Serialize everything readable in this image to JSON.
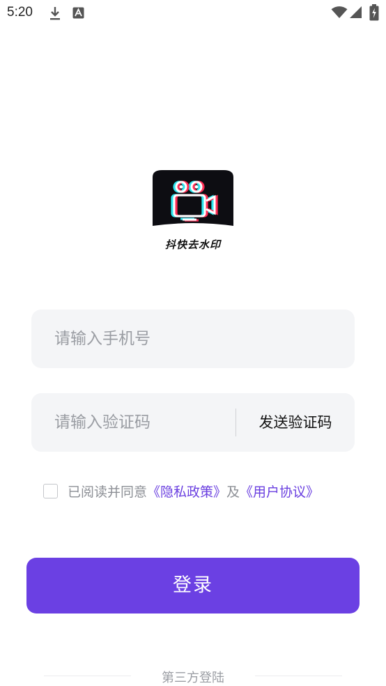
{
  "status_bar": {
    "time": "5:20",
    "left_icons": [
      "download-icon",
      "a-text-icon"
    ],
    "right_icons": [
      "wifi-icon",
      "signal-icon",
      "battery-icon"
    ]
  },
  "logo": {
    "icon": "video-camera-icon",
    "app_name": "抖快去水印",
    "colors": {
      "background": "#0d0d12",
      "cyan": "#2ee6f0",
      "red": "#ff2d55"
    }
  },
  "form": {
    "phone_placeholder": "请输入手机号",
    "code_placeholder": "请输入验证码",
    "send_code_label": "发送验证码"
  },
  "agreement": {
    "checked": false,
    "prefix": "已阅读并同意",
    "privacy_link": "《隐私政策》",
    "joiner": "及",
    "terms_link": "《用户协议》"
  },
  "login_button": "登录",
  "third_party_label": "第三方登陆",
  "colors": {
    "accent": "#6b40e3",
    "link": "#6a3fe0",
    "field_bg": "#f4f5f7",
    "placeholder": "#9a9da3"
  }
}
